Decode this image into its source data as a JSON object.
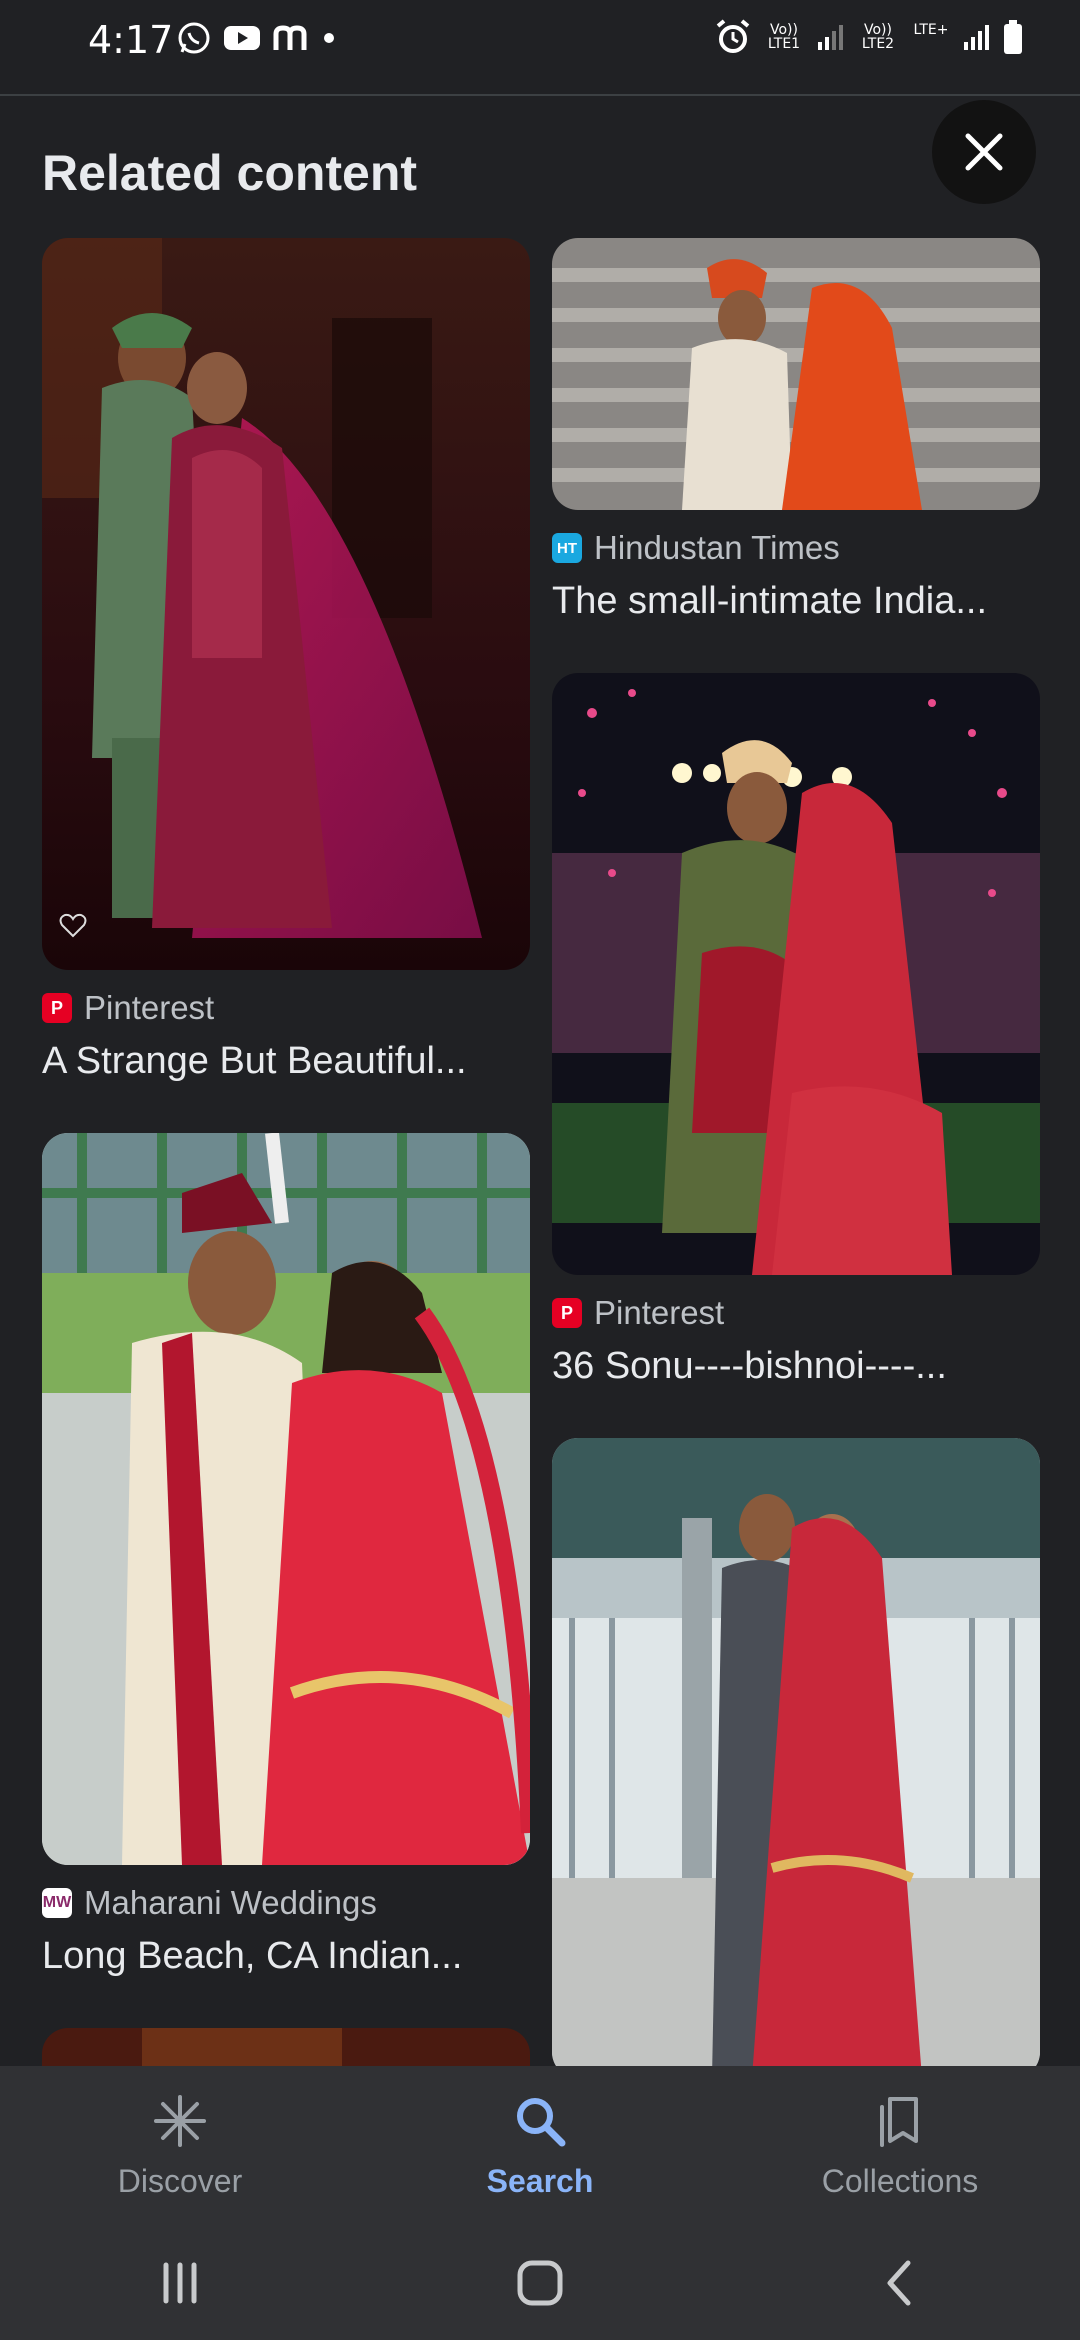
{
  "status": {
    "time": "4:17",
    "sim1": "Vo)) LTE1",
    "sim2": "Vo)) LTE2",
    "lte_plus": "LTE+"
  },
  "header": {
    "title": "Related content"
  },
  "results": [
    {
      "source": "Pinterest",
      "title": "A Strange But Beautiful...",
      "source_icon": "pinterest-icon",
      "icon_color": "#e60023"
    },
    {
      "source": "Hindustan Times",
      "title": "The small-intimate India...",
      "source_icon": "hindustan-times-icon",
      "icon_color": "#1aa8e0"
    },
    {
      "source": "Pinterest",
      "title": "36 Sonu----bishnoi----...",
      "source_icon": "pinterest-icon",
      "icon_color": "#e60023"
    },
    {
      "source": "Maharani Weddings",
      "title": "Long Beach, CA Indian...",
      "source_icon": "maharani-weddings-icon",
      "icon_color": "#ffffff"
    }
  ],
  "bottom_nav": {
    "discover": "Discover",
    "search": "Search",
    "collections": "Collections",
    "active": "search"
  },
  "colors": {
    "background": "#202124",
    "accent": "#8ab4f8",
    "nav_bg": "#303134"
  }
}
